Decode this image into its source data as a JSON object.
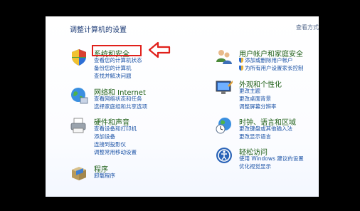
{
  "page": {
    "title": "调整计算机的设置",
    "view_by": "查看方式"
  },
  "categories": [
    {
      "id": "system",
      "title": "系统和安全",
      "links": [
        "查看您的计算机状态",
        "备份您的计算机",
        "查找并解决问题"
      ]
    },
    {
      "id": "network",
      "title": "网络和 Internet",
      "links": [
        "查看网络状态和任务",
        "选择家庭组和共享选项"
      ]
    },
    {
      "id": "hardware",
      "title": "硬件和声音",
      "links": [
        "查看设备和打印机",
        "添加设备",
        "连接到投影仪",
        "调整常用移动设置"
      ]
    },
    {
      "id": "programs",
      "title": "程序",
      "links": [
        "卸载程序"
      ]
    },
    {
      "id": "users",
      "title": "用户帐户和家庭安全",
      "links": [
        "添加或删除用户帐户",
        "为所有用户设置家长控制"
      ]
    },
    {
      "id": "appearance",
      "title": "外观和个性化",
      "links": [
        "更改主题",
        "更改桌面背景",
        "调整屏幕分辨率"
      ]
    },
    {
      "id": "clock",
      "title": "时钟、语言和区域",
      "links": [
        "更改键盘或其他输入法",
        "更改显示语言"
      ]
    },
    {
      "id": "ease",
      "title": "轻松访问",
      "links": [
        "使用 Windows 建议的设置",
        "优化视觉显示"
      ]
    }
  ],
  "annotation": {
    "highlight_color": "#e0201b"
  },
  "colors": {
    "heading": "#1e5f17",
    "link": "#1d54a7",
    "title": "#1b3a75"
  }
}
